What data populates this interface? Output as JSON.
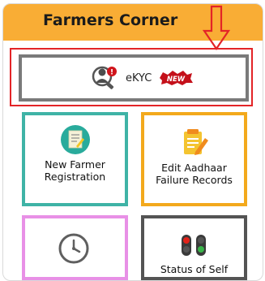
{
  "header": {
    "title": "Farmers Corner"
  },
  "ekyc": {
    "label": "eKYC",
    "badge": "NEW"
  },
  "cards": [
    {
      "label": "New Farmer Registration",
      "icon": "registration-form-icon"
    },
    {
      "label": "Edit Aadhaar Failure Records",
      "icon": "edit-document-icon"
    },
    {
      "label": "",
      "icon": "clock-icon"
    },
    {
      "label": "Status of Self",
      "icon": "traffic-light-icon"
    }
  ],
  "colors": {
    "header": "#f9ad35",
    "highlight": "#e32427",
    "ekyc_border": "#7a7a7a",
    "green": "#3fb3a6",
    "orange": "#f3a91c",
    "pink": "#e890e6",
    "dark": "#545454"
  }
}
